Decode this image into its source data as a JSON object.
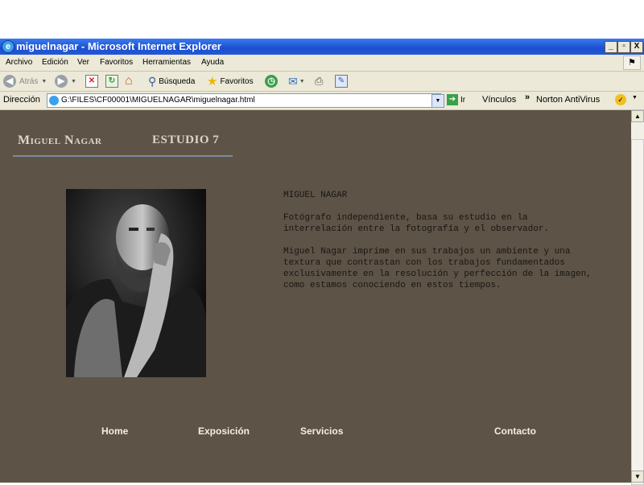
{
  "window": {
    "title": "miguelnagar - Microsoft Internet Explorer",
    "ie_icon": "e",
    "controls": [
      "_",
      "▫",
      "X"
    ]
  },
  "menu": [
    "Archivo",
    "Edición",
    "Ver",
    "Favoritos",
    "Herramientas",
    "Ayuda"
  ],
  "toolbar": {
    "back": "Atrás",
    "search": "Búsqueda",
    "favorites": "Favoritos"
  },
  "address_bar": {
    "label": "Dirección",
    "url": "G:\\FILES\\CF00001\\MIGUELNAGAR\\miguelnagar.html",
    "go": "Ir",
    "links": "Vínculos",
    "links_arrow": "»",
    "antivirus": "Norton AntiVirus"
  },
  "page": {
    "brand_name": "Miguel Nagar",
    "brand_studio": "estudio 7",
    "bio_heading": "MIGUEL NAGAR",
    "bio_p1": "Fotógrafo independiente, basa su estudio en la interrelación entre la fotografía y el observador.",
    "bio_p2": "Miguel Nagar imprime en sus trabajos un ambiente y una textura que contrastan con los trabajos fundamentados exclusivamente en la resolución y perfección de la imagen, como estamos conociendo en estos tiempos.",
    "nav": {
      "home": "Home",
      "exposicion": "Exposición",
      "servicios": "Servicios",
      "contacto": "Contacto"
    }
  },
  "icons": {
    "back": "back-arrow-icon",
    "forward": "forward-arrow-icon",
    "stop": "stop-icon",
    "refresh": "refresh-icon",
    "home": "home-icon",
    "search": "magnifier-icon",
    "favorites": "star-icon",
    "history": "history-icon",
    "mail": "mail-icon",
    "print": "printer-icon",
    "edit": "edit-icon"
  },
  "colors": {
    "content_bg": "#5d5347",
    "nav_text": "#f2efe8",
    "bio_text": "#1a1612"
  }
}
